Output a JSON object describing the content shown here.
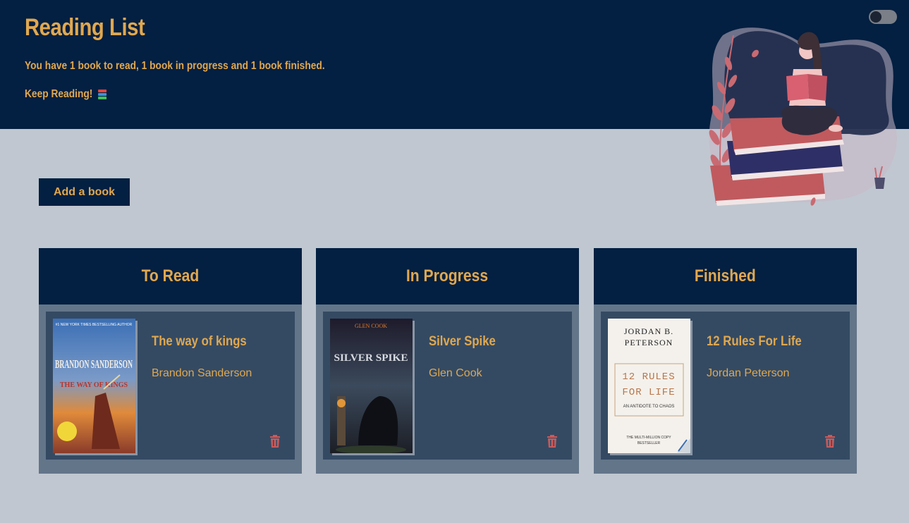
{
  "header": {
    "title": "Reading List",
    "summary": "You have 1 book to read, 1 book in progress and 1 book finished.",
    "keep_reading": "Keep Reading!"
  },
  "theme_toggle": {
    "state": "off"
  },
  "actions": {
    "add_book_label": "Add a book"
  },
  "colors": {
    "navy": "#031f41",
    "gold": "#e0a84f",
    "card": "#344a63",
    "delete": "#c95a5a"
  },
  "columns": [
    {
      "title": "To Read",
      "book": {
        "title": "The way of kings",
        "author": "Brandon Sanderson",
        "cover": {
          "top_line": "#1 NEW YORK TIMES BESTSELLING AUTHOR",
          "author": "BRANDON SANDERSON",
          "title": "THE WAY OF KINGS"
        }
      }
    },
    {
      "title": "In Progress",
      "book": {
        "title": "Silver Spike",
        "author": "Glen Cook",
        "cover": {
          "author": "GLEN COOK",
          "title": "SILVER SPIKE"
        }
      }
    },
    {
      "title": "Finished",
      "book": {
        "title": "12 Rules For Life",
        "author": "Jordan Peterson",
        "cover": {
          "author_line1": "JORDAN B.",
          "author_line2": "PETERSON",
          "title_line1": "12 RULES",
          "title_line2": "FOR LIFE",
          "subtitle": "AN ANTIDOTE TO CHAOS",
          "footer_line1": "THE MULTI-MILLION COPY",
          "footer_line2": "BESTSELLER"
        }
      }
    }
  ]
}
